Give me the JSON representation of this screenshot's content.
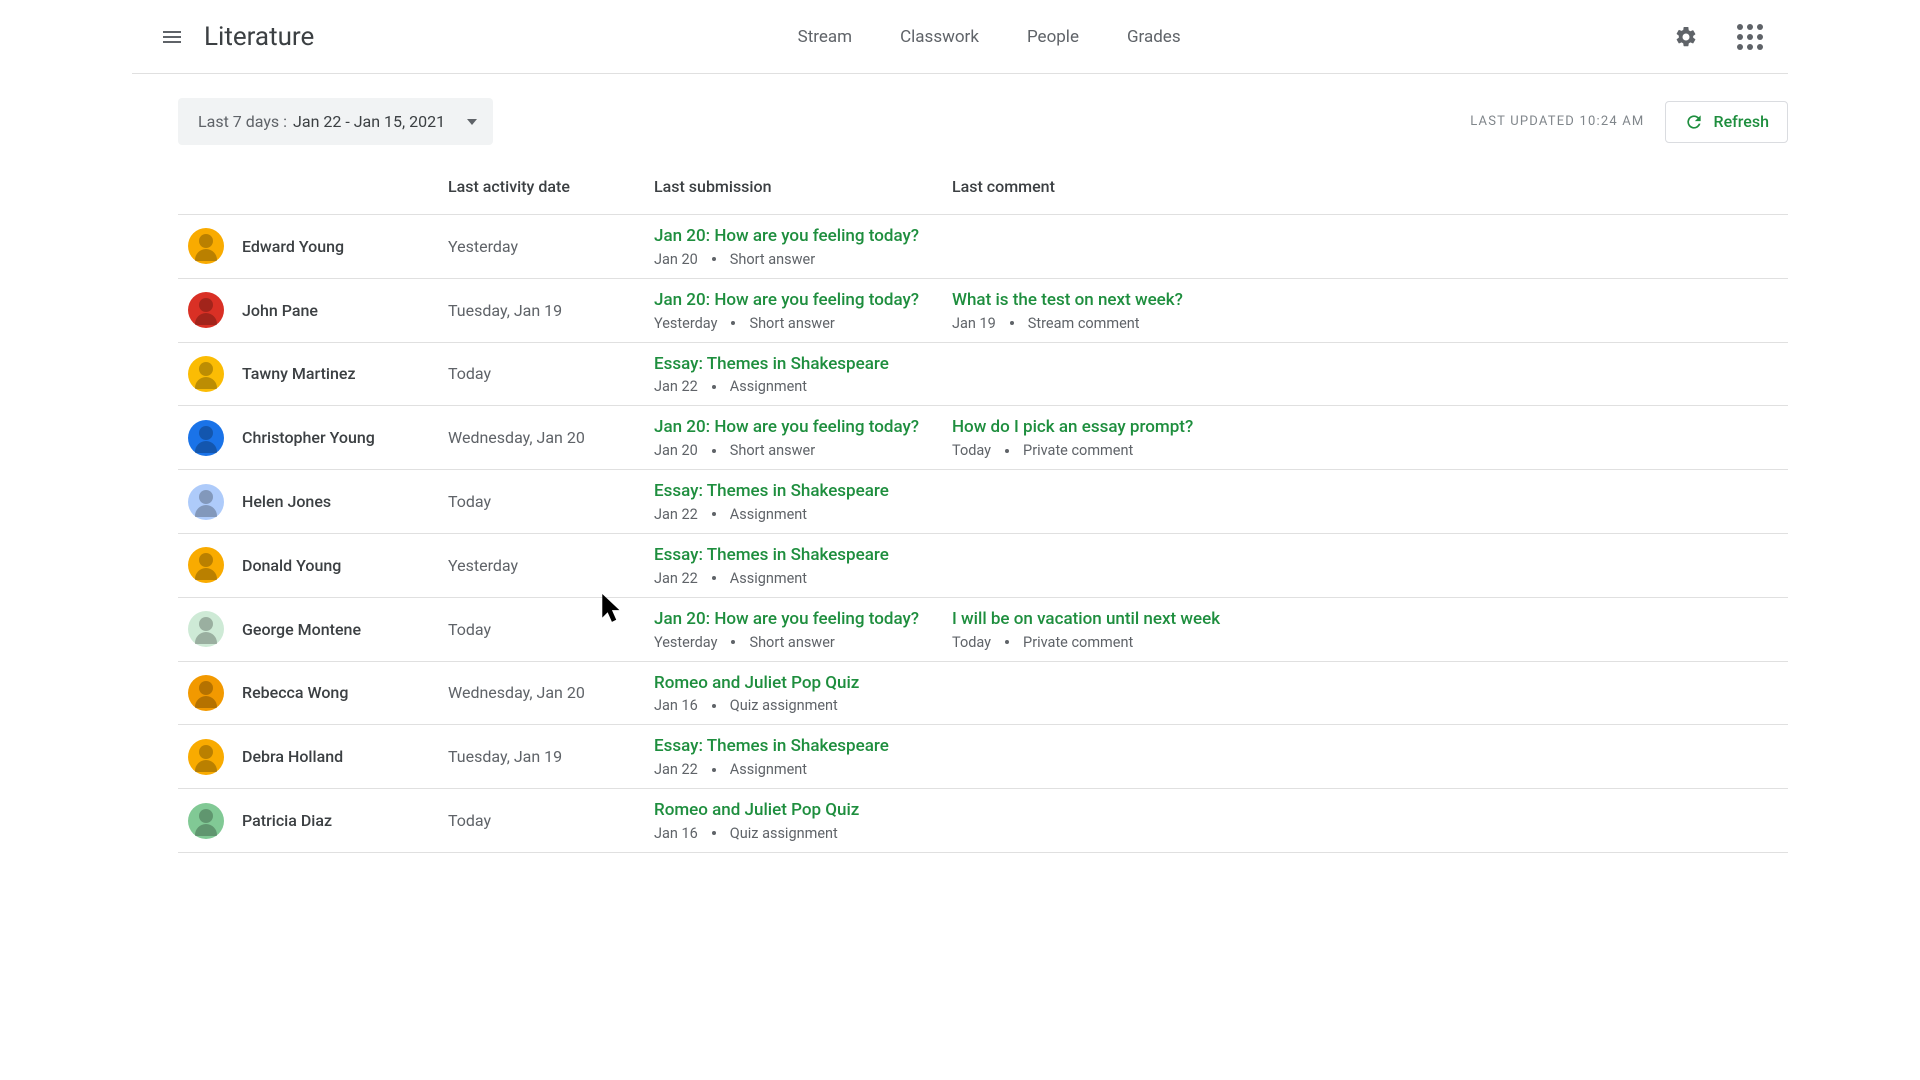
{
  "header": {
    "class_title": "Literature",
    "tabs": [
      "Stream",
      "Classwork",
      "People",
      "Grades"
    ]
  },
  "toolbar": {
    "filter_label": "Last 7 days :",
    "filter_value": "Jan 22 - Jan 15, 2021",
    "last_updated": "LAST UPDATED 10:24 AM",
    "refresh_label": "Refresh"
  },
  "columns": {
    "c1": "",
    "c2": "Last activity date",
    "c3": "Last submission",
    "c4": "Last comment"
  },
  "rows": [
    {
      "name": "Edward Young",
      "avatar_bg": "#f9ab00",
      "activity": "Yesterday",
      "submission": {
        "title": "Jan 20: How are you feeling today?",
        "date": "Jan 20",
        "type": "Short answer"
      },
      "comment": null
    },
    {
      "name": "John Pane",
      "avatar_bg": "#d93025",
      "activity": "Tuesday, Jan 19",
      "submission": {
        "title": "Jan 20: How are you feeling today?",
        "date": "Yesterday",
        "type": "Short answer"
      },
      "comment": {
        "title": "What is the test on next week?",
        "date": "Jan 19",
        "type": "Stream comment"
      }
    },
    {
      "name": "Tawny Martinez",
      "avatar_bg": "#fbbc04",
      "activity": "Today",
      "submission": {
        "title": "Essay: Themes in Shakespeare",
        "date": "Jan 22",
        "type": "Assignment"
      },
      "comment": null
    },
    {
      "name": "Christopher Young",
      "avatar_bg": "#1a73e8",
      "activity": "Wednesday, Jan 20",
      "submission": {
        "title": "Jan 20: How are you feeling today?",
        "date": "Jan 20",
        "type": "Short answer"
      },
      "comment": {
        "title": "How do I pick an essay prompt?",
        "date": "Today",
        "type": "Private comment"
      }
    },
    {
      "name": "Helen Jones",
      "avatar_bg": "#aecbfa",
      "activity": "Today",
      "submission": {
        "title": "Essay: Themes in Shakespeare",
        "date": "Jan 22",
        "type": "Assignment"
      },
      "comment": null
    },
    {
      "name": "Donald Young",
      "avatar_bg": "#f9ab00",
      "activity": "Yesterday",
      "submission": {
        "title": "Essay: Themes in Shakespeare",
        "date": "Jan 22",
        "type": "Assignment"
      },
      "comment": null
    },
    {
      "name": "George Montene",
      "avatar_bg": "#ceead6",
      "activity": "Today",
      "submission": {
        "title": "Jan 20: How are you feeling today?",
        "date": "Yesterday",
        "type": "Short answer"
      },
      "comment": {
        "title": "I will be on vacation until next week",
        "date": "Today",
        "type": "Private comment"
      }
    },
    {
      "name": "Rebecca Wong",
      "avatar_bg": "#f29900",
      "activity": "Wednesday, Jan 20",
      "submission": {
        "title": "Romeo and Juliet Pop Quiz",
        "date": "Jan 16",
        "type": "Quiz assignment"
      },
      "comment": null
    },
    {
      "name": "Debra Holland",
      "avatar_bg": "#f9ab00",
      "activity": "Tuesday, Jan 19",
      "submission": {
        "title": "Essay: Themes in Shakespeare",
        "date": "Jan 22",
        "type": "Assignment"
      },
      "comment": null
    },
    {
      "name": "Patricia Diaz",
      "avatar_bg": "#81c995",
      "activity": "Today",
      "submission": {
        "title": "Romeo and Juliet Pop Quiz",
        "date": "Jan 16",
        "type": "Quiz assignment"
      },
      "comment": null
    }
  ]
}
